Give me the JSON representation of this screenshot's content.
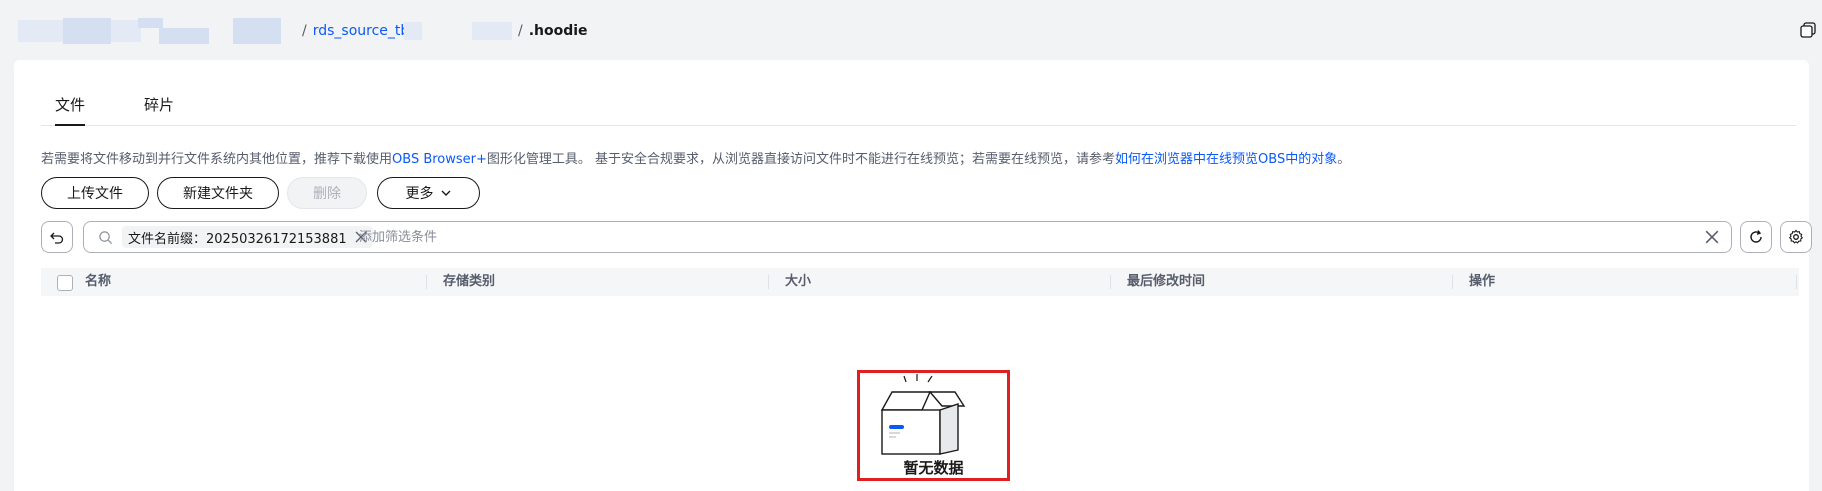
{
  "breadcrumb": {
    "item1": "rds_source_tbl_",
    "item2": ".hoodie"
  },
  "tabs": [
    "文件",
    "碎片"
  ],
  "notice": {
    "text_before": "若需要将文件移动到并行文件系统内其他位置，推荐下载使用",
    "link1": "OBS Browser+",
    "text_middle": "图形化管理工具。 基于安全合规要求，从浏览器直接访问文件时不能进行在线预览；若需要在线预览，请参考",
    "link2": "如何在浏览器中在线预览OBS中的对象",
    "text_end": "。"
  },
  "toolbar": {
    "upload": "上传文件",
    "new_folder": "新建文件夹",
    "delete": "删除",
    "more": "更多"
  },
  "search": {
    "chip": "文件名前缀：20250326172153881",
    "placeholder": "添加筛选条件"
  },
  "table": {
    "columns": [
      "名称",
      "存储类别",
      "大小",
      "最后修改时间",
      "操作"
    ]
  },
  "empty": {
    "text": "暂无数据"
  },
  "colors": {
    "accent": "#0a59f7",
    "highlight": "#e02020"
  }
}
